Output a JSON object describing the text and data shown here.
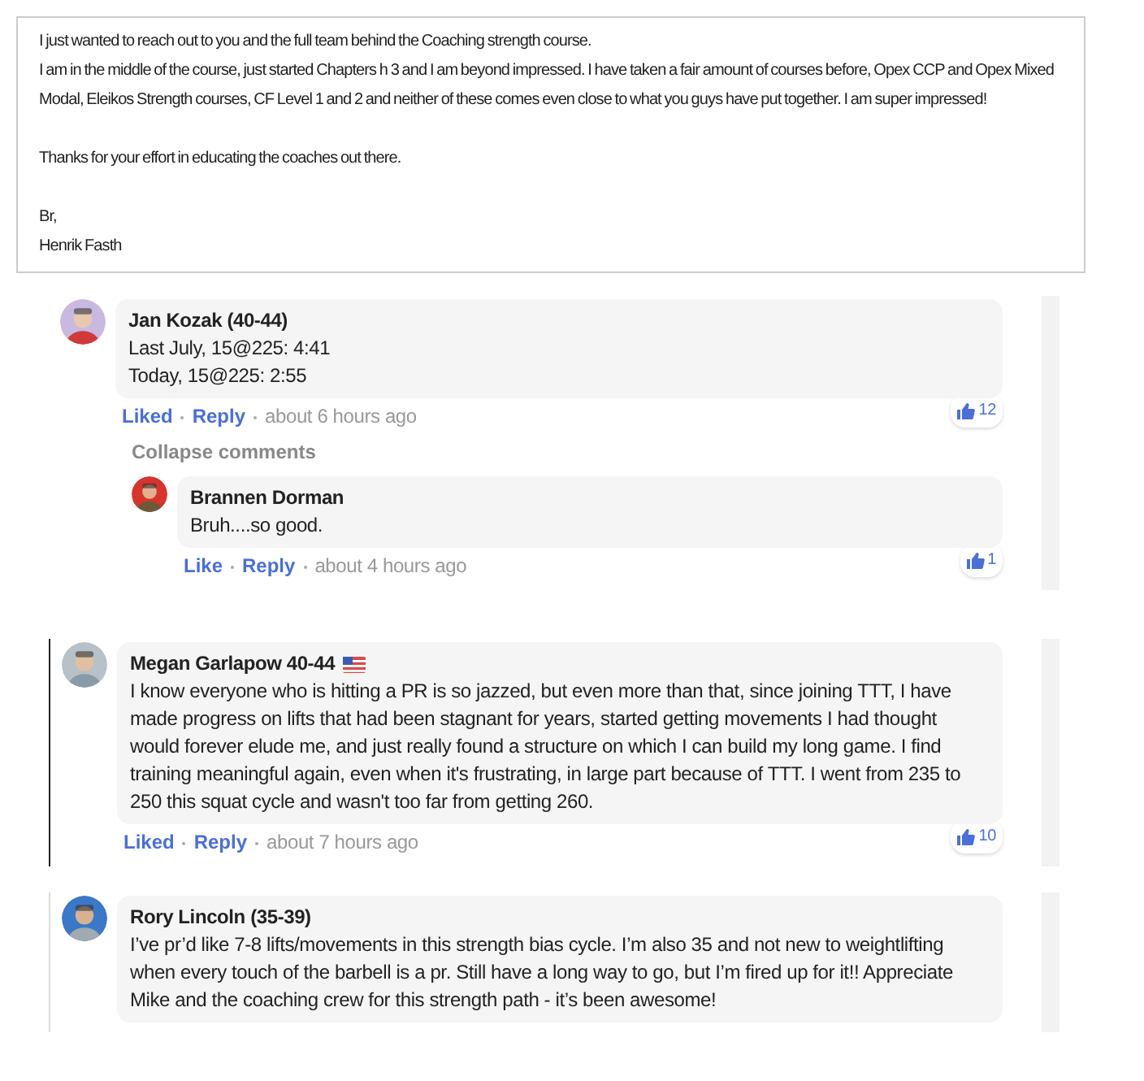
{
  "email": {
    "paragraphs": [
      [
        "I just wanted to reach out to you and the full team behind the Coaching strength course.",
        "I am in the middle of the course, just started Chapters h 3 and I am beyond impressed. I have taken a fair amount of courses before, Opex CCP and Opex Mixed Modal, Eleikos Strength courses, CF Level 1 and 2 and neither of these comes even close to what you guys have put together. I am super impressed!"
      ],
      [
        "Thanks for your effort in educating the coaches out there."
      ],
      [
        "Br,",
        "Henrik Fasth"
      ]
    ]
  },
  "sections": [
    {
      "comment": {
        "author": "Jan Kozak (40-44)",
        "flag": false,
        "lines": [
          "Last July, 15@225: 4:41",
          "Today, 15@225: 2:55"
        ],
        "actions": [
          "Liked",
          "Reply"
        ],
        "time": "about 6 hours ago",
        "likes": "12"
      },
      "collapse": "Collapse comments",
      "replies": [
        {
          "author": "Brannen Dorman",
          "flag": false,
          "lines": [
            "Bruh....so good."
          ],
          "actions": [
            "Like",
            "Reply"
          ],
          "time": "about 4 hours ago",
          "likes": "1"
        }
      ]
    },
    {
      "comment": {
        "author": "Megan Garlapow 40-44",
        "flag": true,
        "lines": [
          "I know everyone who is hitting a PR is so jazzed, but even more than that, since joining TTT, I have made progress on lifts that had been stagnant for years, started getting movements I had thought would forever elude me, and just really found a structure on which I can build my long game. I find training meaningful again, even when it's frustrating, in large part because of TTT. I went from 235 to 250 this squat cycle and wasn't too far from getting 260."
        ],
        "actions": [
          "Liked",
          "Reply"
        ],
        "time": "about 7 hours ago",
        "likes": "10"
      }
    },
    {
      "comment": {
        "author": "Rory Lincoln (35-39)",
        "flag": false,
        "lines": [
          "I’ve pr’d like 7-8 lifts/movements in this strength bias cycle. I’m also 35 and not new to weightlifting when every touch of the barbell is a pr. Still have a long way to go, but I’m fired up for it!! Appreciate Mike and the coaching crew for this strength path - it’s been awesome!"
        ]
      }
    }
  ]
}
